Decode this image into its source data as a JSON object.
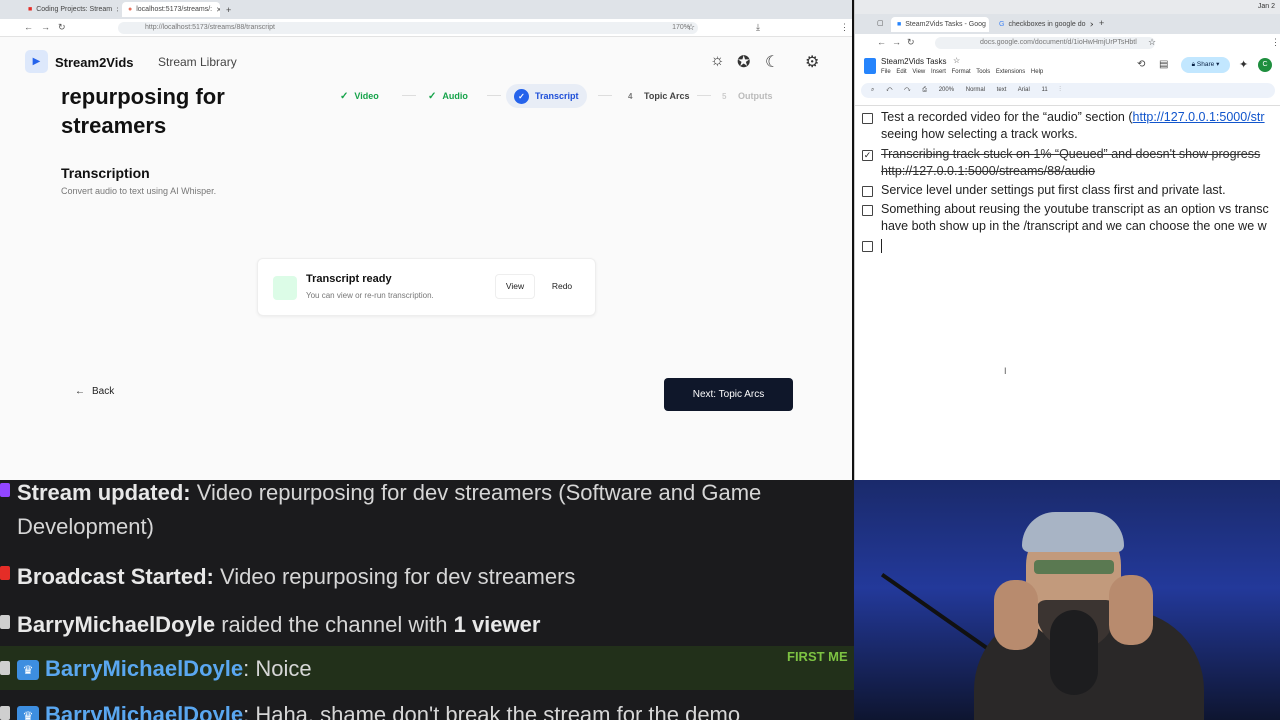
{
  "left_browser": {
    "tabs": [
      {
        "title": "Coding Projects: Stream"
      },
      {
        "title": "localhost:5173/streams/:"
      }
    ],
    "url": "http://localhost:5173/streams/88/transcript",
    "zoom": "170%"
  },
  "app": {
    "brand": "Stream2Vids",
    "nav_library": "Stream Library",
    "hero_line1": "repurposing for",
    "hero_line2": "streamers",
    "steps": [
      {
        "num": "",
        "label": "Video",
        "state": "done"
      },
      {
        "num": "",
        "label": "Audio",
        "state": "done"
      },
      {
        "num": "",
        "label": "Transcript",
        "state": "current"
      },
      {
        "num": "4",
        "label": "Topic Arcs",
        "state": "todo"
      },
      {
        "num": "5",
        "label": "Outputs",
        "state": "disabled"
      }
    ],
    "section_title": "Transcription",
    "section_desc": "Convert audio to text using AI Whisper.",
    "card_title": "Transcript ready",
    "card_desc": "You can view or re-run transcription.",
    "view_label": "View",
    "redo_label": "Redo",
    "back_label": "Back",
    "next_label": "Next: Topic Arcs"
  },
  "right_browser": {
    "tabs": [
      {
        "title": "Steam2Vids Tasks - Goog"
      },
      {
        "title": "checkboxes in google do"
      }
    ],
    "url": "docs.google.com/document/d/1ioHwHmjUrPTsHbtl",
    "date": "Jan 2",
    "doc_title": "Steam2Vids Tasks",
    "menu": [
      "File",
      "Edit",
      "View",
      "Insert",
      "Format",
      "Tools",
      "Extensions",
      "Help"
    ],
    "share_label": "Share",
    "avatar_letter": "C",
    "toolbar": [
      "200%",
      "Normal text",
      "Arial",
      "11"
    ],
    "tasks": [
      {
        "checked": false,
        "line1": "Test a recorded video for the “audio” section (",
        "link": "http://127.0.0.1:5000/str",
        "line2": "seeing how selecting a track works."
      },
      {
        "checked": true,
        "line1": "Transcribing track stuck on 1% “Queued” and doesn't show progress",
        "line2": "http://127.0.0.1:5000/streams/88/audio"
      },
      {
        "checked": false,
        "line1": "Service level under settings put first class first and private last.",
        "line2": ""
      },
      {
        "checked": false,
        "line1": "Something about reusing the youtube transcript as an option vs transc",
        "line2": "have both show up in the /transcript and we can choose the one we w"
      },
      {
        "checked": false,
        "line1": "",
        "line2": ""
      }
    ]
  },
  "chat": {
    "messages": [
      {
        "label": "Stream updated:",
        "text": " Video repurposing for dev streamers (Software and Game",
        "text2": "Development)"
      },
      {
        "label": "Broadcast Started:",
        "text": " Video repurposing for dev streamers"
      },
      {
        "user": "BarryMichaelDoyle",
        "text": " raided the channel with ",
        "count": "1 viewer"
      },
      {
        "user": "BarryMichaelDoyle",
        "text": ": Noice",
        "badge": "FIRST ME"
      },
      {
        "user": "BarryMichaelDoyle",
        "text": ": Haha, shame don't break the stream for the demo"
      }
    ]
  }
}
